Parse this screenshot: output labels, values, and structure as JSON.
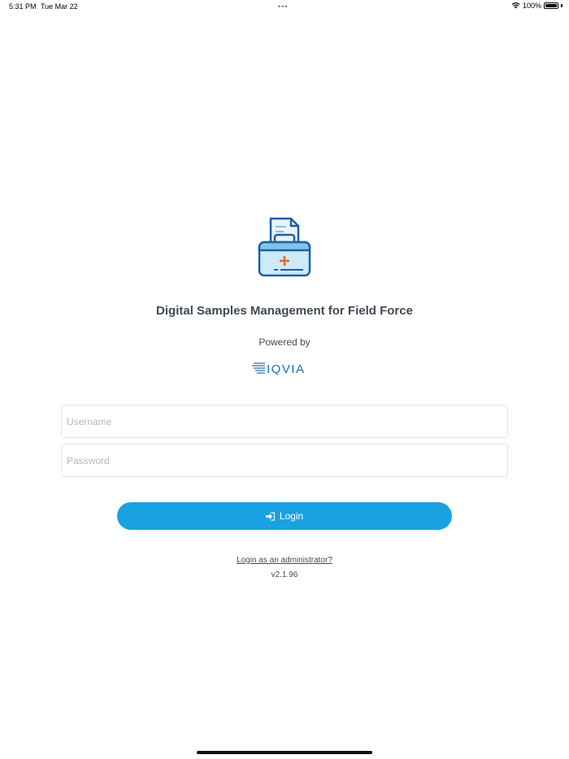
{
  "status_bar": {
    "time": "5:31 PM",
    "date": "Tue Mar 22",
    "multitask_dots": "•••",
    "battery": "100%"
  },
  "app": {
    "title": "Digital Samples Management for Field Force",
    "powered_by": "Powered by",
    "vendor_logo": "IQVIA",
    "logo_icon": "medical-bag-with-document-icon"
  },
  "form": {
    "username_placeholder": "Username",
    "username_value": "",
    "password_placeholder": "Password",
    "password_value": "",
    "login_label": "Login",
    "login_icon": "sign-in-icon"
  },
  "footer": {
    "admin_link": "Login as an administrator?",
    "version": "v2.1.96"
  },
  "colors": {
    "accent": "#1aa1e2",
    "text": "#3f4a55",
    "icon_blue": "#1f5fa6",
    "icon_light": "#cdeaf7",
    "icon_cross": "#e46a2e"
  }
}
